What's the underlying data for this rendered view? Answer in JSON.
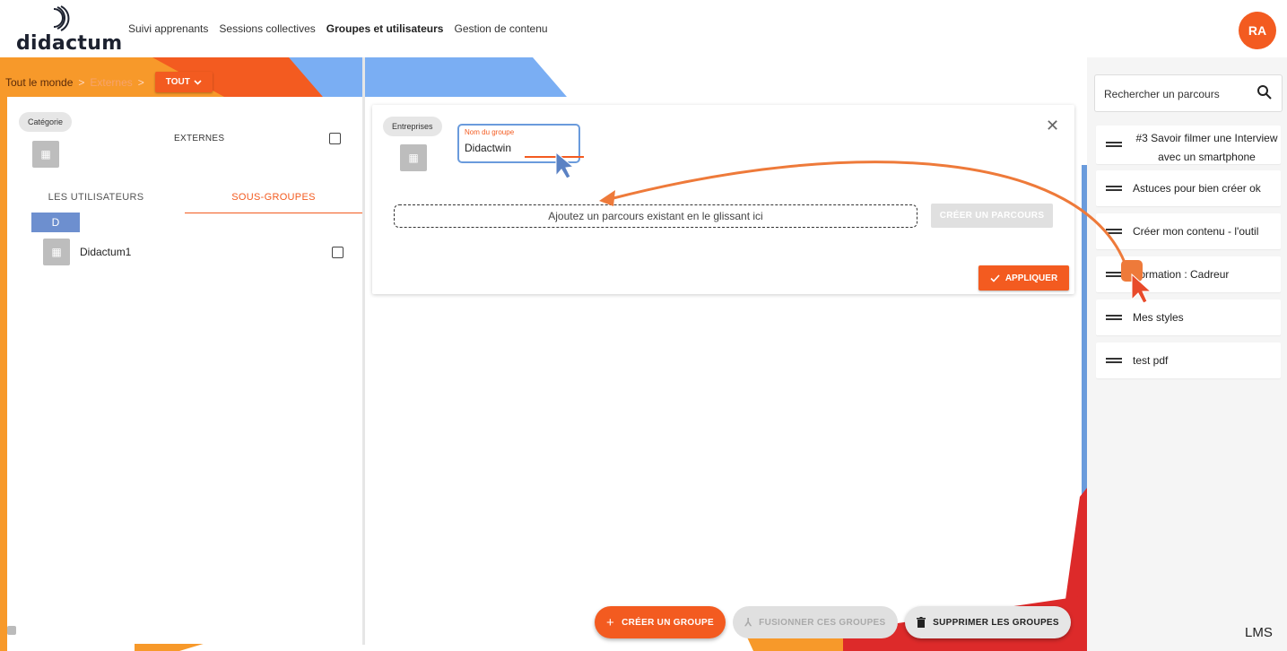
{
  "header": {
    "logo_text": "didactum",
    "nav": [
      "Suivi apprenants",
      "Sessions collectives",
      "Groupes et utilisateurs",
      "Gestion de contenu"
    ],
    "avatar_initials": "RA"
  },
  "breadcrumb": {
    "root": "Tout le monde",
    "current": "Externes",
    "separator": ">",
    "filter_button": "TOUT"
  },
  "left_panel": {
    "category_chip": "Catégorie",
    "category_name": "EXTERNES",
    "tabs": [
      "LES UTILISATEURS",
      "SOUS-GROUPES"
    ],
    "group_letter": "D",
    "subgroups": [
      {
        "name": "Didactum1"
      }
    ]
  },
  "editor": {
    "type_chip": "Entreprises",
    "name_label": "Nom du groupe",
    "name_value": "Didactwin",
    "drop_zone_text": "Ajoutez un parcours existant en le glissant ici",
    "create_parcours_button": "CRÉER UN PARCOURS",
    "apply_button": "APPLIQUER"
  },
  "bottom_actions": {
    "create_group": "CRÉER UN GROUPE",
    "merge_groups": "FUSIONNER CES GROUPES",
    "delete_groups": "SUPPRIMER LES GROUPES"
  },
  "right_panel": {
    "search_placeholder": "Rechercher un parcours",
    "parcours": [
      {
        "line1": "#3 Savoir filmer une Interview",
        "line2": "avec un smartphone"
      },
      {
        "line1": "Astuces pour bien créer ok"
      },
      {
        "line1": "Créer mon contenu - l'outil"
      },
      {
        "line1": "Formation : Cadreur"
      },
      {
        "line1": "Mes styles"
      },
      {
        "line1": "test pdf"
      }
    ]
  },
  "footer": {
    "brand": "LMS"
  },
  "colors": {
    "accent": "#f35b20",
    "blue": "#6a9bdc",
    "orange_light": "#f7992a",
    "red": "#dd2a2a"
  }
}
